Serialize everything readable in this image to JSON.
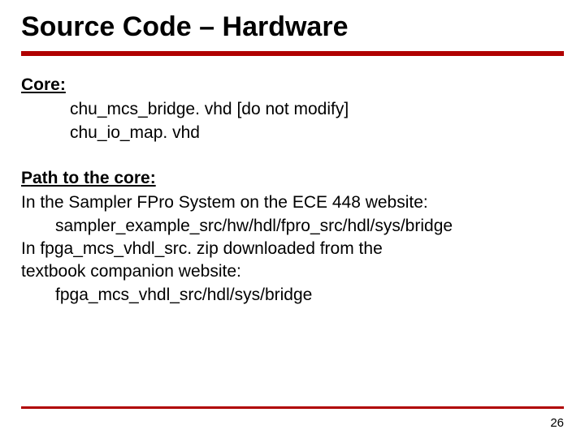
{
  "title": "Source Code – Hardware",
  "core": {
    "label": "Core:",
    "file1": "chu_mcs_bridge. vhd [do not modify]",
    "file2": "chu_io_map. vhd"
  },
  "path": {
    "label": "Path to the core:",
    "line1": "In the Sampler FPro System on the ECE 448 website:",
    "line2": "sampler_example_src/hw/hdl/fpro_src/hdl/sys/bridge",
    "line3": "In fpga_mcs_vhdl_src. zip downloaded from the",
    "line4": "textbook companion website:",
    "line5": "fpga_mcs_vhdl_src/hdl/sys/bridge"
  },
  "page_number": "26"
}
